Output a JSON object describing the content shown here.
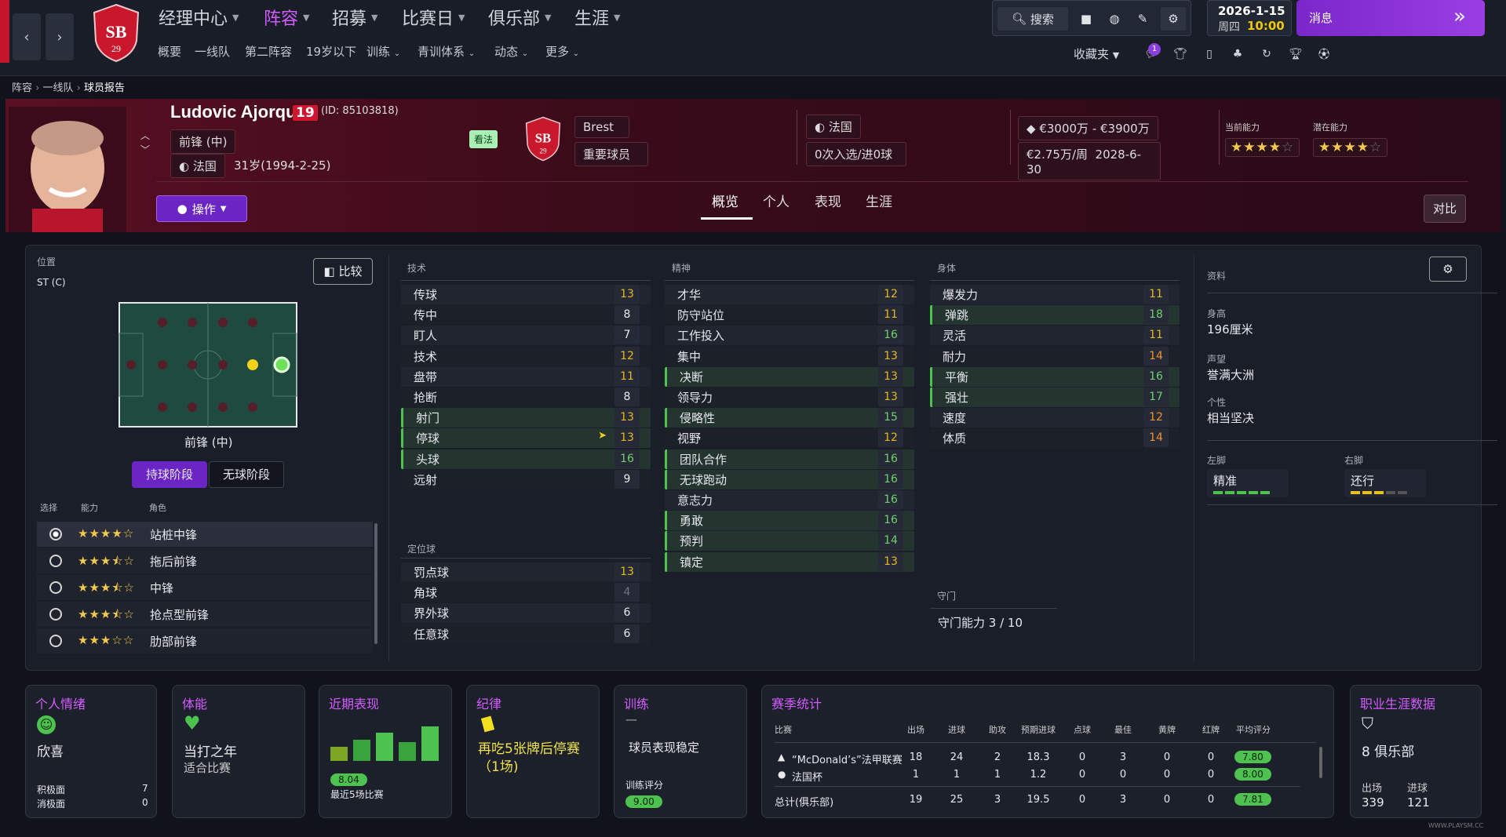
{
  "topnav": {
    "main": [
      {
        "label": "经理中心",
        "active": false
      },
      {
        "label": "阵容",
        "active": true
      },
      {
        "label": "招募",
        "active": false
      },
      {
        "label": "比赛日",
        "active": false
      },
      {
        "label": "俱乐部",
        "active": false
      },
      {
        "label": "生涯",
        "active": false
      }
    ],
    "sub": [
      "概要",
      "一线队",
      "第二阵容",
      "19岁以下",
      "训练",
      "青训体系",
      "动态",
      "更多"
    ],
    "search": "搜索",
    "date": "2026-1-15",
    "weekday": "周四",
    "time": "10:00",
    "messages": "消息",
    "favorites": "收藏夹",
    "notif_count": "1"
  },
  "breadcrumb": [
    "阵容",
    "一线队",
    "球员报告"
  ],
  "player": {
    "name": "Ludovic Ajorque",
    "number": "19",
    "id": "(ID: 85103818)",
    "position": "前锋 (中)",
    "nation": "法国",
    "age": "31岁(1994-2-25)",
    "view": "看法",
    "club": "Brest",
    "status": "重要球员",
    "intl_nation": "法国",
    "intl_caps": "0次入选/进0球",
    "value": "€3000万 - €3900万",
    "wage": "€2.75万/周",
    "contract": "2028-6-30",
    "ca_label": "当前能力",
    "pa_label": "潜在能力",
    "ca_stars": 4,
    "pa_stars": 4,
    "actions": "操作"
  },
  "tabs": [
    "概览",
    "个人",
    "表现",
    "生涯"
  ],
  "compare": "对比",
  "position_panel": {
    "title": "位置",
    "pos": "ST (C)",
    "compare": "比较",
    "pos_name": "前锋 (中)",
    "phase_on": "持球阶段",
    "phase_off": "无球阶段",
    "cols": [
      "选择",
      "能力",
      "角色"
    ],
    "roles": [
      {
        "name": "站桩中锋",
        "stars": 4,
        "half": false,
        "selected": true
      },
      {
        "name": "拖后前锋",
        "stars": 3,
        "half": true,
        "selected": false
      },
      {
        "name": "中锋",
        "stars": 3,
        "half": true,
        "selected": false
      },
      {
        "name": "抢点型前锋",
        "stars": 3,
        "half": true,
        "selected": false
      },
      {
        "name": "肋部前锋",
        "stars": 3,
        "half": false,
        "selected": false
      }
    ]
  },
  "technical": {
    "title": "技术",
    "rows": [
      {
        "n": "传球",
        "v": "13",
        "c": "yellow",
        "h": false
      },
      {
        "n": "传中",
        "v": "8",
        "c": "white",
        "h": false
      },
      {
        "n": "盯人",
        "v": "7",
        "c": "white",
        "h": false
      },
      {
        "n": "技术",
        "v": "12",
        "c": "yellow",
        "h": false
      },
      {
        "n": "盘带",
        "v": "11",
        "c": "yellow",
        "h": false
      },
      {
        "n": "抢断",
        "v": "8",
        "c": "white",
        "h": false
      },
      {
        "n": "射门",
        "v": "13",
        "c": "yellow",
        "h": true
      },
      {
        "n": "停球",
        "v": "13",
        "c": "yellow",
        "h": true
      },
      {
        "n": "头球",
        "v": "16",
        "c": "green",
        "h": true
      },
      {
        "n": "远射",
        "v": "9",
        "c": "white",
        "h": false
      }
    ]
  },
  "setpieces": {
    "title": "定位球",
    "rows": [
      {
        "n": "罚点球",
        "v": "13",
        "c": "yellow",
        "h": false
      },
      {
        "n": "角球",
        "v": "4",
        "c": "grey",
        "h": false
      },
      {
        "n": "界外球",
        "v": "6",
        "c": "white",
        "h": false
      },
      {
        "n": "任意球",
        "v": "6",
        "c": "white",
        "h": false
      }
    ]
  },
  "mental": {
    "title": "精神",
    "rows": [
      {
        "n": "才华",
        "v": "12",
        "c": "yellow",
        "h": false
      },
      {
        "n": "防守站位",
        "v": "11",
        "c": "yellow",
        "h": false
      },
      {
        "n": "工作投入",
        "v": "16",
        "c": "green",
        "h": false
      },
      {
        "n": "集中",
        "v": "13",
        "c": "yellow",
        "h": false
      },
      {
        "n": "决断",
        "v": "13",
        "c": "yellow",
        "h": true
      },
      {
        "n": "领导力",
        "v": "13",
        "c": "yellow",
        "h": false
      },
      {
        "n": "侵略性",
        "v": "15",
        "c": "green",
        "h": true
      },
      {
        "n": "视野",
        "v": "12",
        "c": "yellow",
        "h": false
      },
      {
        "n": "团队合作",
        "v": "16",
        "c": "green",
        "h": true
      },
      {
        "n": "无球跑动",
        "v": "16",
        "c": "green",
        "h": true
      },
      {
        "n": "意志力",
        "v": "16",
        "c": "green",
        "h": false
      },
      {
        "n": "勇敢",
        "v": "16",
        "c": "green",
        "h": true
      },
      {
        "n": "预判",
        "v": "14",
        "c": "green",
        "h": true
      },
      {
        "n": "镇定",
        "v": "13",
        "c": "yellow",
        "h": true
      }
    ]
  },
  "physical": {
    "title": "身体",
    "rows": [
      {
        "n": "爆发力",
        "v": "11",
        "c": "yellow",
        "h": false
      },
      {
        "n": "弹跳",
        "v": "18",
        "c": "green",
        "h": true
      },
      {
        "n": "灵活",
        "v": "11",
        "c": "yellow",
        "h": false
      },
      {
        "n": "耐力",
        "v": "14",
        "c": "orange",
        "h": false
      },
      {
        "n": "平衡",
        "v": "16",
        "c": "green",
        "h": true
      },
      {
        "n": "强壮",
        "v": "17",
        "c": "green",
        "h": true
      },
      {
        "n": "速度",
        "v": "12",
        "c": "orange",
        "h": false
      },
      {
        "n": "体质",
        "v": "14",
        "c": "orange",
        "h": false
      }
    ]
  },
  "goalkeeping": {
    "title": "守门",
    "text": "守门能力 3 / 10"
  },
  "info": {
    "title": "资料",
    "height_label": "身高",
    "height": "196厘米",
    "rep_label": "声望",
    "rep": "誉满大洲",
    "pers_label": "个性",
    "pers": "相当坚决",
    "left_label": "左脚",
    "left": "精准",
    "right_label": "右脚",
    "right": "还行"
  },
  "cards": {
    "morale": {
      "t": "个人情绪",
      "v": "欣喜",
      "pos_l": "积极面",
      "pos_v": "7",
      "neg_l": "消极面",
      "neg_v": "0"
    },
    "fitness": {
      "t": "体能",
      "v1": "当打之年",
      "v2": "适合比赛"
    },
    "form": {
      "t": "近期表现",
      "rating": "8.04",
      "sub": "最近5场比赛",
      "bars": [
        7.2,
        7.8,
        8.4,
        7.6,
        8.9
      ]
    },
    "disc": {
      "t": "纪律",
      "v": "再吃5张牌后停赛（1场)"
    },
    "training": {
      "t": "训练",
      "dash": "—",
      "v": "球员表现稳定",
      "rl": "训练评分",
      "r": "9.00"
    },
    "season": {
      "t": "赛季统计",
      "cols": [
        "比赛",
        "出场",
        "进球",
        "助攻",
        "预期进球",
        "点球",
        "最佳",
        "黄牌",
        "红牌",
        "平均评分"
      ],
      "rows": [
        [
          "“McDonald’s”法甲联赛",
          "18",
          "24",
          "2",
          "18.3",
          "0",
          "3",
          "0",
          "0",
          "7.80"
        ],
        [
          "法国杯",
          "1",
          "1",
          "1",
          "1.2",
          "0",
          "0",
          "0",
          "0",
          "8.00"
        ],
        [
          "总计(俱乐部)",
          "19",
          "25",
          "3",
          "19.5",
          "0",
          "3",
          "0",
          "0",
          "7.81"
        ]
      ]
    },
    "career": {
      "t": "职业生涯数据",
      "clubs": "8 俱乐部",
      "apps_l": "出场",
      "apps": "339",
      "goals_l": "进球",
      "goals": "121"
    }
  },
  "watermark": "WWW.PLAYSM.CC"
}
